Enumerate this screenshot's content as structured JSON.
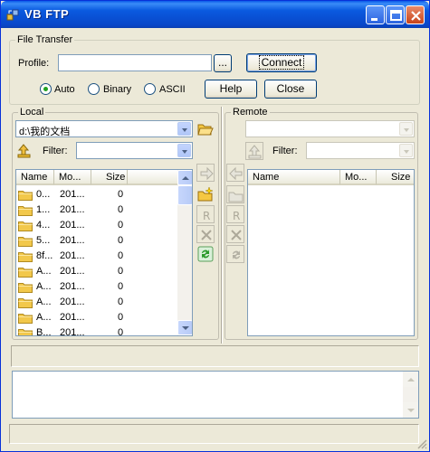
{
  "window": {
    "title": "VB FTP"
  },
  "file_transfer": {
    "legend": "File Transfer",
    "profile_label": "Profile:",
    "profile_value": "",
    "browse_label": "...",
    "connect_label": "Connect",
    "mode_options": [
      {
        "label": "Auto",
        "selected": true
      },
      {
        "label": "Binary",
        "selected": false
      },
      {
        "label": "ASCII",
        "selected": false
      }
    ],
    "help_label": "Help",
    "close_label": "Close"
  },
  "local": {
    "legend": "Local",
    "path": "d:\\我的文档",
    "filter_label": "Filter:",
    "filter_value": "",
    "columns": [
      "Name",
      "Mo...",
      "Size"
    ],
    "rows": [
      {
        "name": "0...",
        "modified": "201...",
        "size": "0"
      },
      {
        "name": "1...",
        "modified": "201...",
        "size": "0"
      },
      {
        "name": "4...",
        "modified": "201...",
        "size": "0"
      },
      {
        "name": "5...",
        "modified": "201...",
        "size": "0"
      },
      {
        "name": "8f...",
        "modified": "201...",
        "size": "0"
      },
      {
        "name": "A...",
        "modified": "201...",
        "size": "0"
      },
      {
        "name": "A...",
        "modified": "201...",
        "size": "0"
      },
      {
        "name": "A...",
        "modified": "201...",
        "size": "0"
      },
      {
        "name": "A...",
        "modified": "201...",
        "size": "0"
      },
      {
        "name": "B...",
        "modified": "201...",
        "size": "0"
      }
    ]
  },
  "remote": {
    "legend": "Remote",
    "path": "",
    "filter_label": "Filter:",
    "filter_value": "",
    "columns": [
      "Name",
      "Mo...",
      "Size"
    ],
    "rows": []
  },
  "status": {
    "text": ""
  },
  "log": {
    "text": ""
  }
}
